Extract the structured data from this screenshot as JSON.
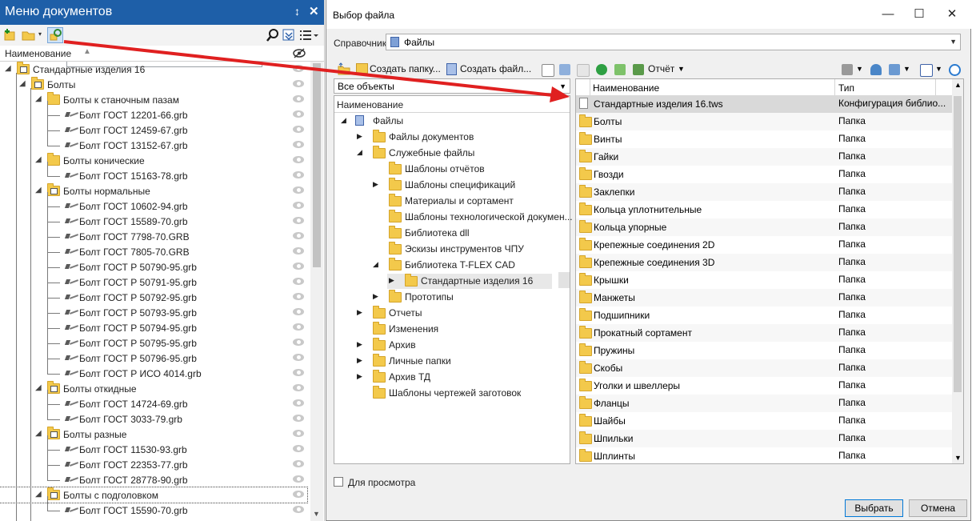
{
  "left_panel": {
    "title": "Меню документов",
    "pin_glyph": "↕",
    "close_glyph": "✕",
    "column_header": "Наименование",
    "tree": [
      {
        "label": "Стандартные изделия 16",
        "level": 0,
        "icon": "library-icon",
        "expanded": true
      },
      {
        "label": "Болты",
        "level": 1,
        "icon": "folder-library-icon",
        "expanded": true
      },
      {
        "label": "Болты к станочным пазам",
        "level": 2,
        "icon": "folder-icon",
        "expanded": true
      },
      {
        "label": "Болт ГОСТ 12201-66.grb",
        "level": 3,
        "icon": "bolt-icon"
      },
      {
        "label": "Болт ГОСТ 12459-67.grb",
        "level": 3,
        "icon": "bolt-icon"
      },
      {
        "label": "Болт ГОСТ 13152-67.grb",
        "level": 3,
        "icon": "bolt-icon"
      },
      {
        "label": "Болты конические",
        "level": 2,
        "icon": "folder-icon",
        "expanded": true
      },
      {
        "label": "Болт ГОСТ 15163-78.grb",
        "level": 3,
        "icon": "bolt-icon"
      },
      {
        "label": "Болты нормальные",
        "level": 2,
        "icon": "folder-library-icon",
        "expanded": true
      },
      {
        "label": "Болт ГОСТ 10602-94.grb",
        "level": 3,
        "icon": "bolt-icon"
      },
      {
        "label": "Болт ГОСТ 15589-70.grb",
        "level": 3,
        "icon": "bolt-icon"
      },
      {
        "label": "Болт ГОСТ 7798-70.GRB",
        "level": 3,
        "icon": "bolt-icon"
      },
      {
        "label": "Болт ГОСТ 7805-70.GRB",
        "level": 3,
        "icon": "bolt-icon"
      },
      {
        "label": "Болт ГОСТ Р 50790-95.grb",
        "level": 3,
        "icon": "bolt-icon"
      },
      {
        "label": "Болт ГОСТ Р 50791-95.grb",
        "level": 3,
        "icon": "bolt-icon"
      },
      {
        "label": "Болт ГОСТ Р 50792-95.grb",
        "level": 3,
        "icon": "bolt-icon"
      },
      {
        "label": "Болт ГОСТ Р 50793-95.grb",
        "level": 3,
        "icon": "bolt-icon"
      },
      {
        "label": "Болт ГОСТ Р 50794-95.grb",
        "level": 3,
        "icon": "bolt-icon"
      },
      {
        "label": "Болт ГОСТ Р 50795-95.grb",
        "level": 3,
        "icon": "bolt-icon"
      },
      {
        "label": "Болт ГОСТ Р 50796-95.grb",
        "level": 3,
        "icon": "bolt-icon"
      },
      {
        "label": "Болт ГОСТ Р ИСО 4014.grb",
        "level": 3,
        "icon": "bolt-icon"
      },
      {
        "label": "Болты откидные",
        "level": 2,
        "icon": "folder-library-icon",
        "expanded": true
      },
      {
        "label": "Болт ГОСТ 14724-69.grb",
        "level": 3,
        "icon": "bolt-icon"
      },
      {
        "label": "Болт ГОСТ 3033-79.grb",
        "level": 3,
        "icon": "bolt-icon"
      },
      {
        "label": "Болты разные",
        "level": 2,
        "icon": "folder-library-icon",
        "expanded": true
      },
      {
        "label": "Болт ГОСТ 11530-93.grb",
        "level": 3,
        "icon": "bolt-icon"
      },
      {
        "label": "Болт ГОСТ 22353-77.grb",
        "level": 3,
        "icon": "bolt-icon"
      },
      {
        "label": "Болт ГОСТ 28778-90.grb",
        "level": 3,
        "icon": "bolt-icon"
      },
      {
        "label": "Болты с подголовком",
        "level": 2,
        "icon": "folder-library-icon",
        "expanded": true,
        "selected": true
      },
      {
        "label": "Болт ГОСТ 15590-70.grb",
        "level": 3,
        "icon": "bolt-icon"
      }
    ]
  },
  "dialog": {
    "title": "Выбор файла",
    "minimize_glyph": "—",
    "maximize_glyph": "☐",
    "close_glyph": "✕",
    "reference_label": "Справочник",
    "reference_value": "Файлы",
    "toolbar": {
      "create_folder": "Создать папку...",
      "create_file": "Создать файл...",
      "report": "Отчёт"
    },
    "filter_value": "Все объекты",
    "tree_header": "Наименование",
    "tree": [
      {
        "label": "Файлы",
        "level": 0,
        "toggle": "◢",
        "icon": "library-icon"
      },
      {
        "label": "Файлы документов",
        "level": 1,
        "toggle": "▶"
      },
      {
        "label": "Служебные файлы",
        "level": 1,
        "toggle": "◢"
      },
      {
        "label": "Шаблоны отчётов",
        "level": 2,
        "toggle": ""
      },
      {
        "label": "Шаблоны спецификаций",
        "level": 2,
        "toggle": "▶"
      },
      {
        "label": "Материалы и сортамент",
        "level": 2,
        "toggle": ""
      },
      {
        "label": "Шаблоны технологической докумен...",
        "level": 2,
        "toggle": ""
      },
      {
        "label": "Библиотека dll",
        "level": 2,
        "toggle": ""
      },
      {
        "label": "Эскизы инструментов ЧПУ",
        "level": 2,
        "toggle": ""
      },
      {
        "label": "Библиотека T-FLEX CAD",
        "level": 2,
        "toggle": "◢"
      },
      {
        "label": "Стандартные изделия 16",
        "level": 3,
        "toggle": "▶",
        "selected": true
      },
      {
        "label": "Прототипы",
        "level": 2,
        "toggle": "▶"
      },
      {
        "label": "Отчеты",
        "level": 1,
        "toggle": "▶"
      },
      {
        "label": "Изменения",
        "level": 1,
        "toggle": ""
      },
      {
        "label": "Архив",
        "level": 1,
        "toggle": "▶"
      },
      {
        "label": "Личные папки",
        "level": 1,
        "toggle": "▶"
      },
      {
        "label": "Архив ТД",
        "level": 1,
        "toggle": "▶"
      },
      {
        "label": "Шаблоны чертежей заготовок",
        "level": 1,
        "toggle": ""
      }
    ],
    "list_headers": {
      "name": "Наименование",
      "type": "Тип"
    },
    "list": [
      {
        "name": "Стандартные изделия 16.tws",
        "type": "Конфигурация библио...",
        "icon": "document-icon",
        "selected": true
      },
      {
        "name": "Болты",
        "type": "Папка",
        "icon": "folder-icon"
      },
      {
        "name": "Винты",
        "type": "Папка",
        "icon": "folder-icon"
      },
      {
        "name": "Гайки",
        "type": "Папка",
        "icon": "folder-icon"
      },
      {
        "name": "Гвозди",
        "type": "Папка",
        "icon": "folder-icon"
      },
      {
        "name": "Заклепки",
        "type": "Папка",
        "icon": "folder-icon"
      },
      {
        "name": "Кольца уплотнительные",
        "type": "Папка",
        "icon": "folder-icon"
      },
      {
        "name": "Кольца упорные",
        "type": "Папка",
        "icon": "folder-icon"
      },
      {
        "name": "Крепежные соединения 2D",
        "type": "Папка",
        "icon": "folder-icon"
      },
      {
        "name": "Крепежные соединения 3D",
        "type": "Папка",
        "icon": "folder-icon"
      },
      {
        "name": "Крышки",
        "type": "Папка",
        "icon": "folder-icon"
      },
      {
        "name": "Манжеты",
        "type": "Папка",
        "icon": "folder-icon"
      },
      {
        "name": "Подшипники",
        "type": "Папка",
        "icon": "folder-icon"
      },
      {
        "name": "Прокатный сортамент",
        "type": "Папка",
        "icon": "folder-icon"
      },
      {
        "name": "Пружины",
        "type": "Папка",
        "icon": "folder-icon"
      },
      {
        "name": "Скобы",
        "type": "Папка",
        "icon": "folder-icon"
      },
      {
        "name": "Уголки и швеллеры",
        "type": "Папка",
        "icon": "folder-icon"
      },
      {
        "name": "Фланцы",
        "type": "Папка",
        "icon": "folder-icon"
      },
      {
        "name": "Шайбы",
        "type": "Папка",
        "icon": "folder-icon"
      },
      {
        "name": "Шпильки",
        "type": "Папка",
        "icon": "folder-icon"
      },
      {
        "name": "Шплинты",
        "type": "Папка",
        "icon": "folder-icon"
      }
    ],
    "preview_label": "Для просмотра",
    "select_button": "Выбрать",
    "cancel_button": "Отмена"
  },
  "colors": {
    "panel_title_bg": "#1e5fa8",
    "annotation_arrow": "#e02020",
    "folder": "#f3c94b"
  }
}
